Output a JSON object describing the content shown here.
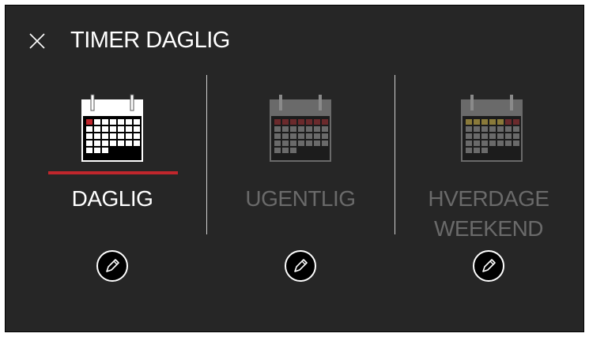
{
  "header": {
    "title": "TIMER DAGLIG",
    "close_icon": "close-icon"
  },
  "options": [
    {
      "id": "daglig",
      "label": "DAGLIG",
      "selected": true,
      "edit_icon": "pencil-icon"
    },
    {
      "id": "ugentlig",
      "label": "UGENTLIG",
      "selected": false,
      "edit_icon": "pencil-icon"
    },
    {
      "id": "hverdage-weekend",
      "label_line1": "HVERDAGE",
      "label_line2": "WEEKEND",
      "selected": false,
      "edit_icon": "pencil-icon"
    }
  ],
  "colors": {
    "background": "#262626",
    "accent": "#c0262c",
    "active_text": "#ffffff",
    "inactive_text": "#6a6a6a",
    "weekday_marker": "#8a7a3a"
  }
}
